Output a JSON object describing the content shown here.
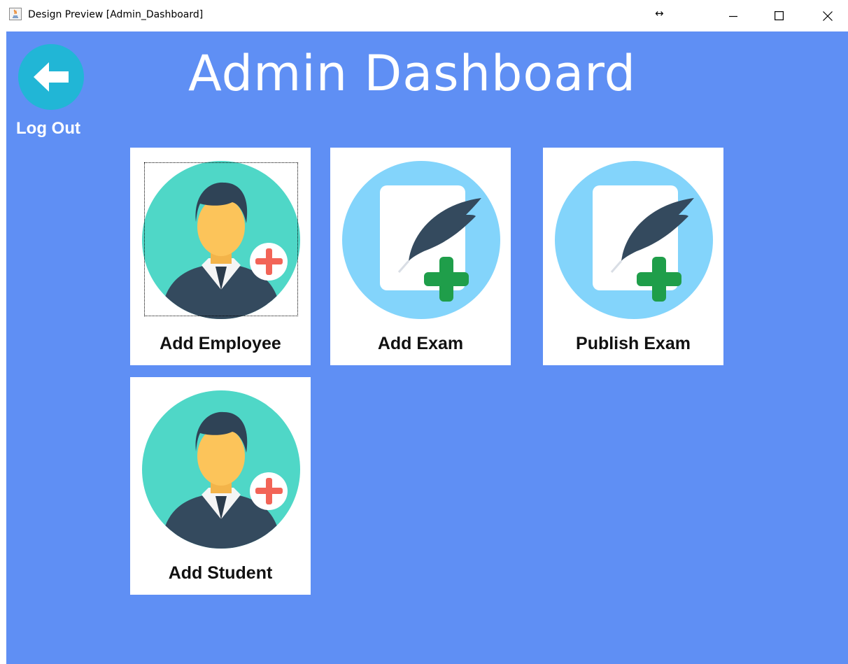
{
  "window": {
    "title": "Design Preview [Admin_Dashboard]",
    "resize_glyph": "↔",
    "controls": [
      "minimize-icon",
      "maximize-icon",
      "close-icon"
    ]
  },
  "colors": {
    "background": "#5f8ff4",
    "logout_circle": "#21b6d6",
    "employee_bg": "#4fd7c7",
    "exam_bg": "#83d4fb",
    "plus_green": "#1f9e4a",
    "plus_red": "#f26457",
    "suit": "#344a5e"
  },
  "header": {
    "title": "Admin Dashboard",
    "logout_label": "Log Out",
    "logout_icon": "arrow-left-icon"
  },
  "cards": [
    {
      "label": "Add Employee",
      "icon": "add-person-icon"
    },
    {
      "label": "Add Exam",
      "icon": "add-document-feather-icon"
    },
    {
      "label": "Publish Exam",
      "icon": "add-document-feather-icon"
    },
    {
      "label": "Add Student",
      "icon": "add-person-icon"
    }
  ]
}
